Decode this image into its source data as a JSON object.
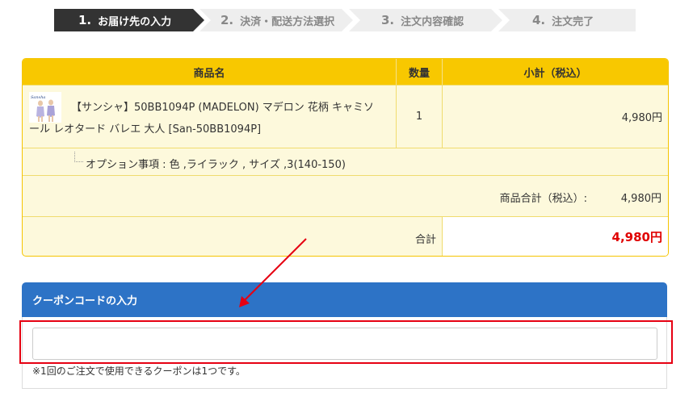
{
  "steps": [
    {
      "num": "1.",
      "label": "お届け先の入力"
    },
    {
      "num": "2.",
      "label": "決済・配送方法選択"
    },
    {
      "num": "3.",
      "label": "注文内容確認"
    },
    {
      "num": "4.",
      "label": "注文完了"
    }
  ],
  "cart": {
    "headers": {
      "name": "商品名",
      "qty": "数量",
      "subtotal": "小計（税込）"
    },
    "item": {
      "name_line1": "【サンシャ】50BB1094P (MADELON) マデロン 花柄 キャミソ",
      "name_line2": "ール レオタード バレエ 大人 [San-50BB1094P]",
      "thumb_label": "Sansha",
      "qty": "1",
      "price": "4,980円"
    },
    "option_text": "オプション事項 : 色 ,ライラック , サイズ ,3(140-150)",
    "subtotal_label": "商品合計（税込）:",
    "subtotal_value": "4,980円",
    "total_label": "合計",
    "total_value": "4,980円"
  },
  "coupon": {
    "title": "クーポンコードの入力",
    "input_value": "",
    "note": "※1回のご注文で使用できるクーポンは1つです。"
  },
  "colors": {
    "header_yellow": "#f8c800",
    "row_bg": "#fdf9dc",
    "coupon_blue": "#2d73c6",
    "total_red": "#e00000",
    "annotation_red": "#e60012"
  }
}
